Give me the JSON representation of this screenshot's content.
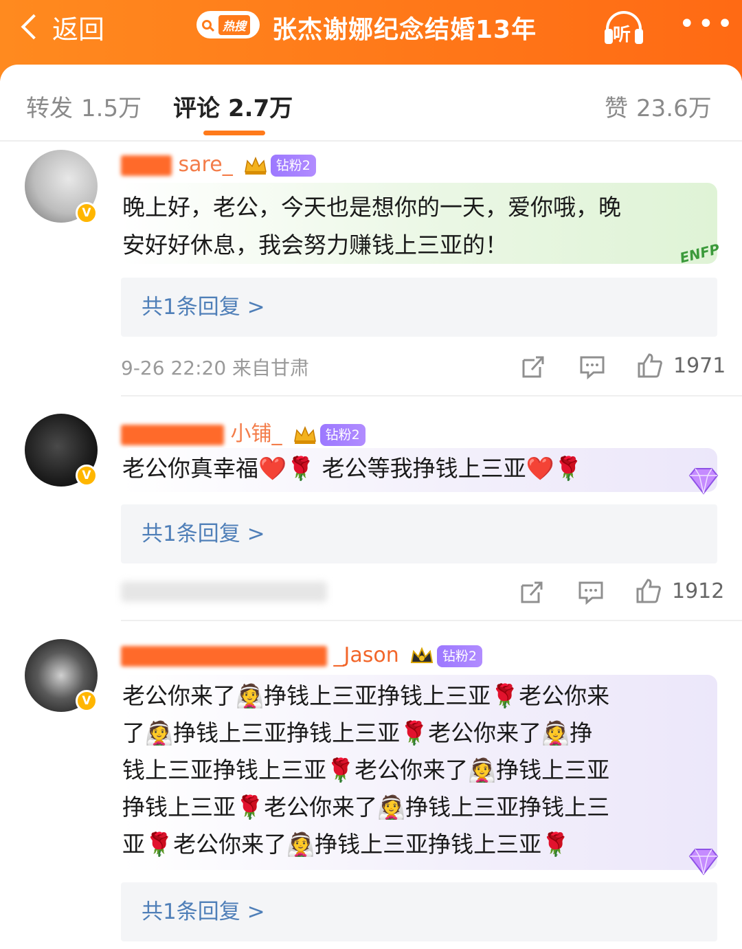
{
  "header": {
    "back_label": "返回",
    "hot_badge": "热搜",
    "title": "张杰谢娜纪念结婚13年",
    "listen_label": "听",
    "more_label": "•••"
  },
  "tabs": [
    {
      "label": "转发",
      "count": "1.5万"
    },
    {
      "label": "评论",
      "count": "2.7万"
    },
    {
      "label": "赞",
      "count": "23.6万"
    }
  ],
  "colors": {
    "brand_orange": "#ff7a1a",
    "username_orange": "#f2662a",
    "link_blue": "#4f7fb8"
  },
  "comments": [
    {
      "username_visible": "sare_",
      "fan_badge": "钻粉2",
      "text_line1": "晚上好，老公，今天也是想你的一天，爱你哦，晚",
      "text_line2": "安好好休息，我会努力赚钱上三亚的！",
      "bubble_tag": "ENFP",
      "replies_label": "共1条回复 >",
      "meta": "9-26 22:20  来自甘肃",
      "likes": "1971"
    },
    {
      "username_visible": "小铺_",
      "fan_badge": "钻粉2",
      "text_line1": "老公你真幸福❤️🌹 老公等我挣钱上三亚❤️🌹",
      "replies_label": "共1条回复 >",
      "likes": "1912"
    },
    {
      "username_visible": "_Jason",
      "fan_badge": "钻粉2",
      "lines": [
        "老公你来了👰挣钱上三亚挣钱上三亚🌹老公你来",
        "了👰挣钱上三亚挣钱上三亚🌹老公你来了👰挣",
        "钱上三亚挣钱上三亚🌹老公你来了👰挣钱上三亚",
        "挣钱上三亚🌹老公你来了👰挣钱上三亚挣钱上三",
        "亚🌹老公你来了👰挣钱上三亚挣钱上三亚🌹"
      ],
      "replies_label": "共1条回复 >"
    }
  ]
}
